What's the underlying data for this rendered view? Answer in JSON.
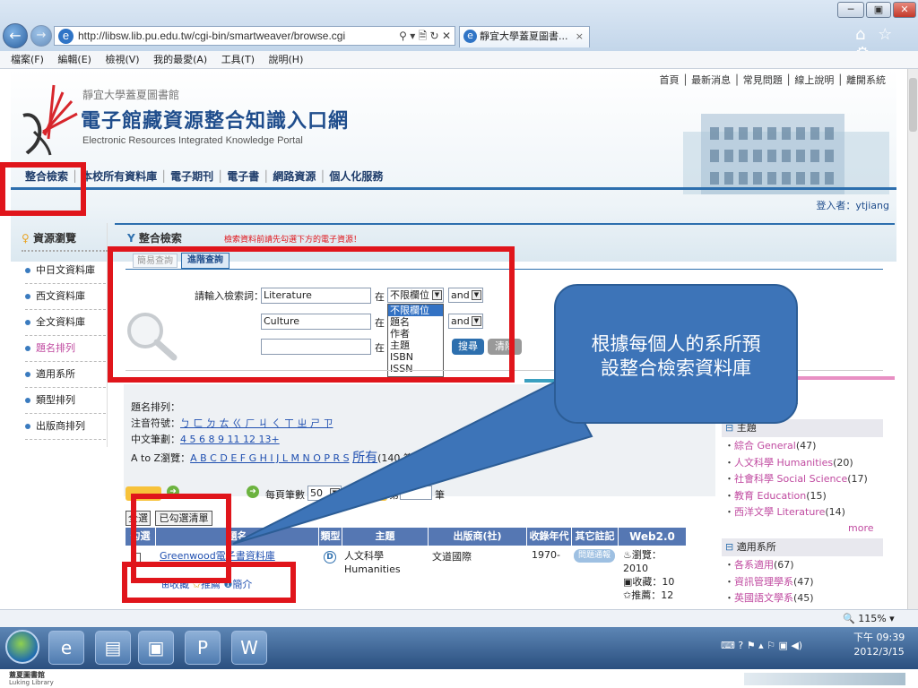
{
  "browser": {
    "window_controls": {
      "minimize": "─",
      "restore": "▣",
      "close": "✕"
    },
    "back_icon": "←",
    "forward_icon": "→",
    "address": "http://libsw.lib.pu.edu.tw/cgi-bin/smartweaver/browse.cgi",
    "addr_icons": "⚲ ▾ 🗎 ↻ ✕",
    "tab_title": "靜宜大學蓋夏圖書...",
    "tab_close": "×",
    "right_icons": "⌂ ☆ ⚙",
    "menu": [
      "檔案(F)",
      "編輯(E)",
      "檢視(V)",
      "我的最愛(A)",
      "工具(T)",
      "說明(H)"
    ]
  },
  "header": {
    "library_name": "靜宜大學蓋夏圖書館",
    "portal_title": "電子館藏資源整合知識入口網",
    "portal_subtitle": "Electronic Resources Integrated Knowledge Portal",
    "top_links": [
      "首頁",
      "最新消息",
      "常見問題",
      "線上說明",
      "離開系統"
    ],
    "nav": [
      "整合檢索",
      "本校所有資料庫",
      "電子期刊",
      "電子書",
      "網路資源",
      "個人化服務"
    ],
    "login_label": "登入者：",
    "login_user": "ytjiang"
  },
  "sidebar": {
    "title": "資源瀏覽",
    "items": [
      "中日文資料庫",
      "西文資料庫",
      "全文資料庫",
      "題名排列",
      "適用系所",
      "類型排列",
      "出版商排列"
    ]
  },
  "search": {
    "title": "整合檢索",
    "hint": "檢索資料前請先勾選下方的電子資源！",
    "tab_simple": "簡易查詢",
    "tab_advanced": "進階查詢",
    "prompt": "請輸入檢索詞：",
    "term1": "Literature",
    "term2": "Culture",
    "term3": "",
    "in_label": "在",
    "field_selected": "不限欄位",
    "field_options": [
      "不限欄位",
      "題名",
      "作者",
      "主題",
      "ISBN",
      "ISSN"
    ],
    "bool1": "and",
    "bool2": "and",
    "search_btn": "搜尋",
    "clear_btn": "清除"
  },
  "callout": {
    "text_line1": "根據每個人的系所預",
    "text_line2": "設整合檢索資料庫"
  },
  "browse": {
    "title_sort_label": "題名排列：",
    "zhuyin_label": "注音符號：",
    "zhuyin": "ㄅ ㄈ ㄉ ㄊ ㄍ ㄏ ㄐ ㄑ ㄒ ㄓ ㄕ ㄗ",
    "strokes_label": "中文筆劃：",
    "strokes": "4 5 6 8 9 11 12 13+",
    "az_label": "A to Z瀏覽：",
    "az": "A B C D E F G H I J L M N O P R S",
    "all_label": "所有",
    "count": "(140 筆)",
    "per_page_label": "每頁筆數",
    "per_page": "50",
    "go_label": "GO",
    "page_prefix": "第",
    "page_suffix": "筆",
    "select_all_btn": "全選",
    "checked_list_btn": "已勾選清單",
    "columns": [
      "勾選",
      "題名",
      "類型",
      "主題",
      "出版商(社)",
      "收錄年代",
      "其它註記",
      "Web2.0"
    ],
    "row": {
      "title": "Greenwood電子書資料庫",
      "type_icon": "D",
      "subject": "人文科學 Humanities",
      "publisher": "文道國際",
      "years": "1970-",
      "note": "問題通報",
      "web_views_label": "瀏覽：",
      "web_views": "2010",
      "web_fav": "收藏：10",
      "web_rec": "推薦：12",
      "actions": [
        "收藏",
        "推薦",
        "簡介"
      ]
    }
  },
  "right_panel": {
    "heading": "題",
    "subject_title": "主題",
    "subjects": [
      {
        "name": "綜合 General",
        "count": "(47)"
      },
      {
        "name": "人文科學 Humanities",
        "count": "(20)"
      },
      {
        "name": "社會科學 Social Science",
        "count": "(17)"
      },
      {
        "name": "教育 Education",
        "count": "(15)"
      },
      {
        "name": "西洋文學 Literature",
        "count": "(14)"
      }
    ],
    "more": "more",
    "dept_title": "適用系所",
    "depts": [
      {
        "name": "各系適用",
        "count": "(67)"
      },
      {
        "name": "資訊管理學系",
        "count": "(47)"
      },
      {
        "name": "英國語文學系",
        "count": "(45)"
      }
    ]
  },
  "status": {
    "zoom": "115%"
  },
  "taskbar": {
    "time": "下午 09:39",
    "date": "2012/3/15",
    "tray_icons": "⌨ ? ⚑ ▴ ⚐ ▣ ◀)"
  },
  "footer": {
    "line1": "蓋夏圖書館",
    "line2": "Luking Library"
  }
}
